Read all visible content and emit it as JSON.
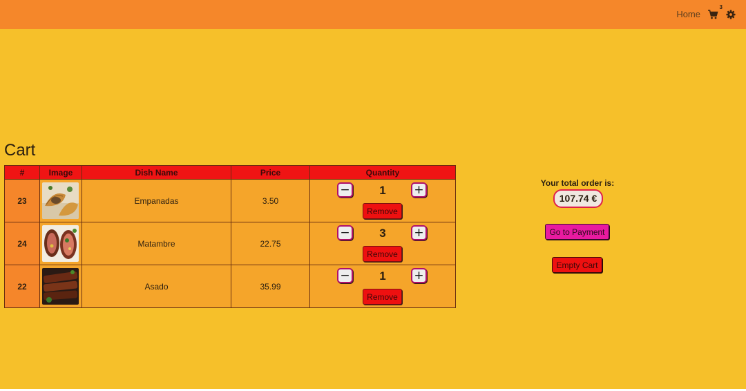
{
  "nav": {
    "home_label": "Home",
    "cart_count": "3",
    "cart_icon": "cart-icon",
    "settings_icon": "gear-icon"
  },
  "page": {
    "title": "Cart"
  },
  "table": {
    "headers": {
      "id": "#",
      "image": "Image",
      "name": "Dish Name",
      "price": "Price",
      "quantity": "Quantity"
    },
    "rows": [
      {
        "id": "23",
        "name": "Empanadas",
        "price": "3.50",
        "quantity": "1",
        "remove_label": "Remove",
        "minus": "−",
        "plus": "+"
      },
      {
        "id": "24",
        "name": "Matambre",
        "price": "22.75",
        "quantity": "3",
        "remove_label": "Remove",
        "minus": "−",
        "plus": "+"
      },
      {
        "id": "22",
        "name": "Asado",
        "price": "35.99",
        "quantity": "1",
        "remove_label": "Remove",
        "minus": "−",
        "plus": "+"
      }
    ]
  },
  "summary": {
    "label": "Your total order is:",
    "total": "107.74 €",
    "pay_label": "Go to Payment",
    "empty_label": "Empty Cart"
  },
  "colors": {
    "background": "#f6c02a",
    "navbar": "#f5872a",
    "header": "#f01414",
    "row": "#f5a52a",
    "pay_button": "#e81aa0",
    "danger": "#ee1010"
  }
}
